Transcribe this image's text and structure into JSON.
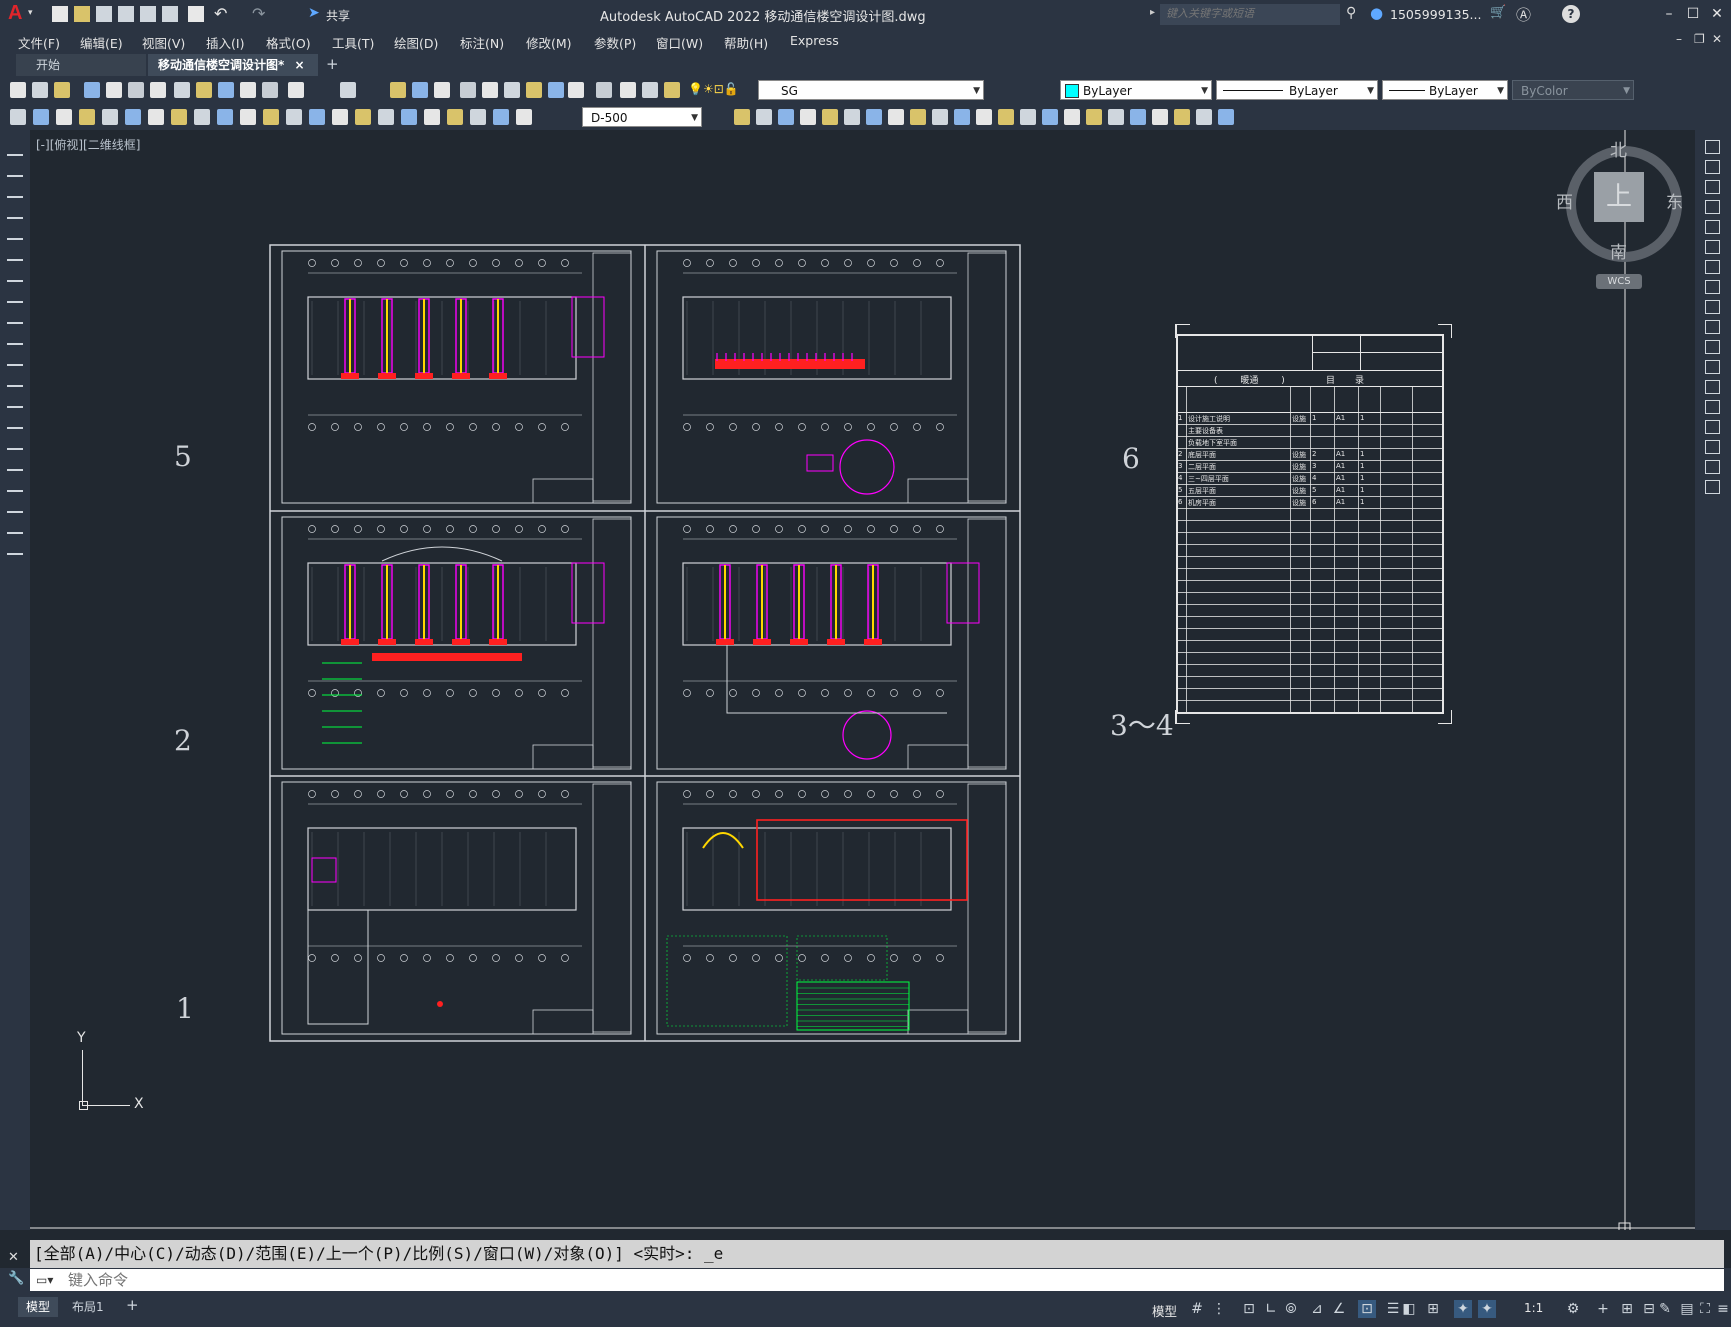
{
  "titlebar": {
    "app_letter": "A",
    "share_label": "共享",
    "title": "Autodesk AutoCAD 2022    移动通信楼空调设计图.dwg",
    "search_placeholder": "键入关键字或短语",
    "user": "1505999135...",
    "help": "?"
  },
  "menu": [
    "文件(F)",
    "编辑(E)",
    "视图(V)",
    "插入(I)",
    "格式(O)",
    "工具(T)",
    "绘图(D)",
    "标注(N)",
    "修改(M)",
    "参数(P)",
    "窗口(W)",
    "帮助(H)",
    "Express"
  ],
  "tabs": {
    "start": "开始",
    "active": "移动通信楼空调设计图*",
    "close": "×",
    "new": "+"
  },
  "layers": {
    "current_layer": "SG",
    "color": "ByLayer",
    "linetype": "ByLayer",
    "lineweight": "ByLayer",
    "plotstyle": "ByColor",
    "dimstyle": "D-500"
  },
  "viewport": {
    "label": "[-][俯视][二维线框]",
    "viewcube": {
      "north": "北",
      "south": "南",
      "east": "东",
      "west": "西",
      "face": "上",
      "wcs": "WCS"
    },
    "ucs": {
      "x": "X",
      "y": "Y"
    },
    "sheet_numbers": {
      "s5": "5",
      "s6": "6",
      "s2": "2",
      "s34": "3～4",
      "s1": "1"
    }
  },
  "drawing_index": {
    "header_left": "(        暖通        )",
    "header_right": "目       录",
    "rows": [
      {
        "no": "1",
        "name": "设计施工说明",
        "code": "设施",
        "n": "1",
        "size": "A1",
        "q": "1"
      },
      {
        "no": "",
        "name": "主要设备表",
        "code": "",
        "n": "",
        "size": "",
        "q": ""
      },
      {
        "no": "",
        "name": "负载地下室平面",
        "code": "",
        "n": "",
        "size": "",
        "q": ""
      },
      {
        "no": "2",
        "name": "底层平面",
        "code": "设施",
        "n": "2",
        "size": "A1",
        "q": "1"
      },
      {
        "no": "3",
        "name": "二层平面",
        "code": "设施",
        "n": "3",
        "size": "A1",
        "q": "1"
      },
      {
        "no": "4",
        "name": "三~四层平面",
        "code": "设施",
        "n": "4",
        "size": "A1",
        "q": "1"
      },
      {
        "no": "5",
        "name": "五层平面",
        "code": "设施",
        "n": "5",
        "size": "A1",
        "q": "1"
      },
      {
        "no": "6",
        "name": "机房平面",
        "code": "设施",
        "n": "6",
        "size": "A1",
        "q": "1"
      }
    ]
  },
  "command": {
    "history": "[全部(A)/中心(C)/动态(D)/范围(E)/上一个(P)/比例(S)/窗口(W)/对象(O)] <实时>: _e",
    "placeholder": "键入命令"
  },
  "status": {
    "tab_model": "模型",
    "tab_layout": "布局1",
    "tab_add": "+",
    "mode": "模型",
    "scale": "1:1"
  },
  "colors": {
    "magenta": "#ff00ff",
    "red": "#ff2020",
    "yellow": "#ffd700",
    "green": "#00ff40",
    "line": "#cfd3d8",
    "cyan": "#00ffff"
  }
}
